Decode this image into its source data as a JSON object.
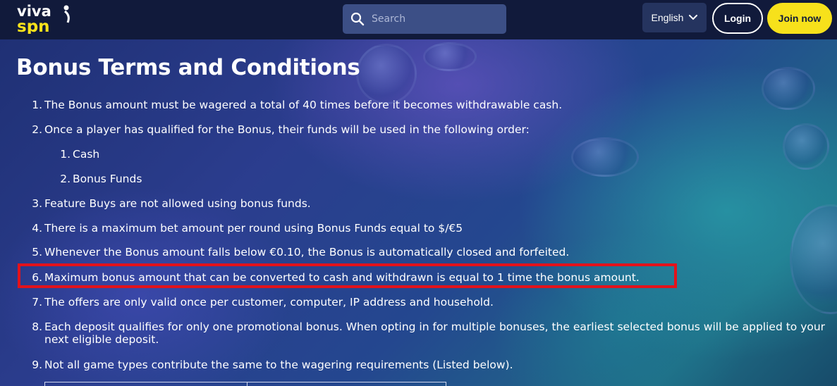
{
  "header": {
    "logo_text": "viva spin",
    "search_placeholder": "Search",
    "language": "English",
    "login_label": "Login",
    "join_label": "Join now"
  },
  "page": {
    "title": "Bonus Terms and Conditions",
    "terms": [
      {
        "num": "1.",
        "text": "The Bonus amount must be wagered a total of 40 times before it becomes withdrawable cash."
      },
      {
        "num": "2.",
        "text": "Once a player has qualified for the Bonus, their funds will be used in the following order:"
      },
      {
        "num": "1.",
        "text": "Cash"
      },
      {
        "num": "2.",
        "text": "Bonus Funds"
      },
      {
        "num": "3.",
        "text": "Feature Buys are not allowed using bonus funds."
      },
      {
        "num": "4.",
        "text": "There is a maximum bet amount per round using Bonus Funds equal to $/€5"
      },
      {
        "num": "5.",
        "text": "Whenever the Bonus amount falls below €0.10, the Bonus is automatically closed and forfeited."
      },
      {
        "num": "6.",
        "text": "Maximum bonus amount that can be converted to cash and withdrawn is equal to 1 time the bonus amount."
      },
      {
        "num": "7.",
        "text": "The offers are only valid once per customer, computer, IP address and household."
      },
      {
        "num": "8.",
        "text": "Each deposit qualifies for only one promotional bonus. When opting in for multiple bonuses, the earliest selected bonus will be applied to your next eligible deposit."
      },
      {
        "num": "9.",
        "text": "Not all game types contribute the same to the wagering requirements (Listed below)."
      }
    ]
  },
  "colors": {
    "topbar": "#111a3b",
    "brand_yellow": "#f7e11b",
    "highlight": "#e3121b"
  }
}
